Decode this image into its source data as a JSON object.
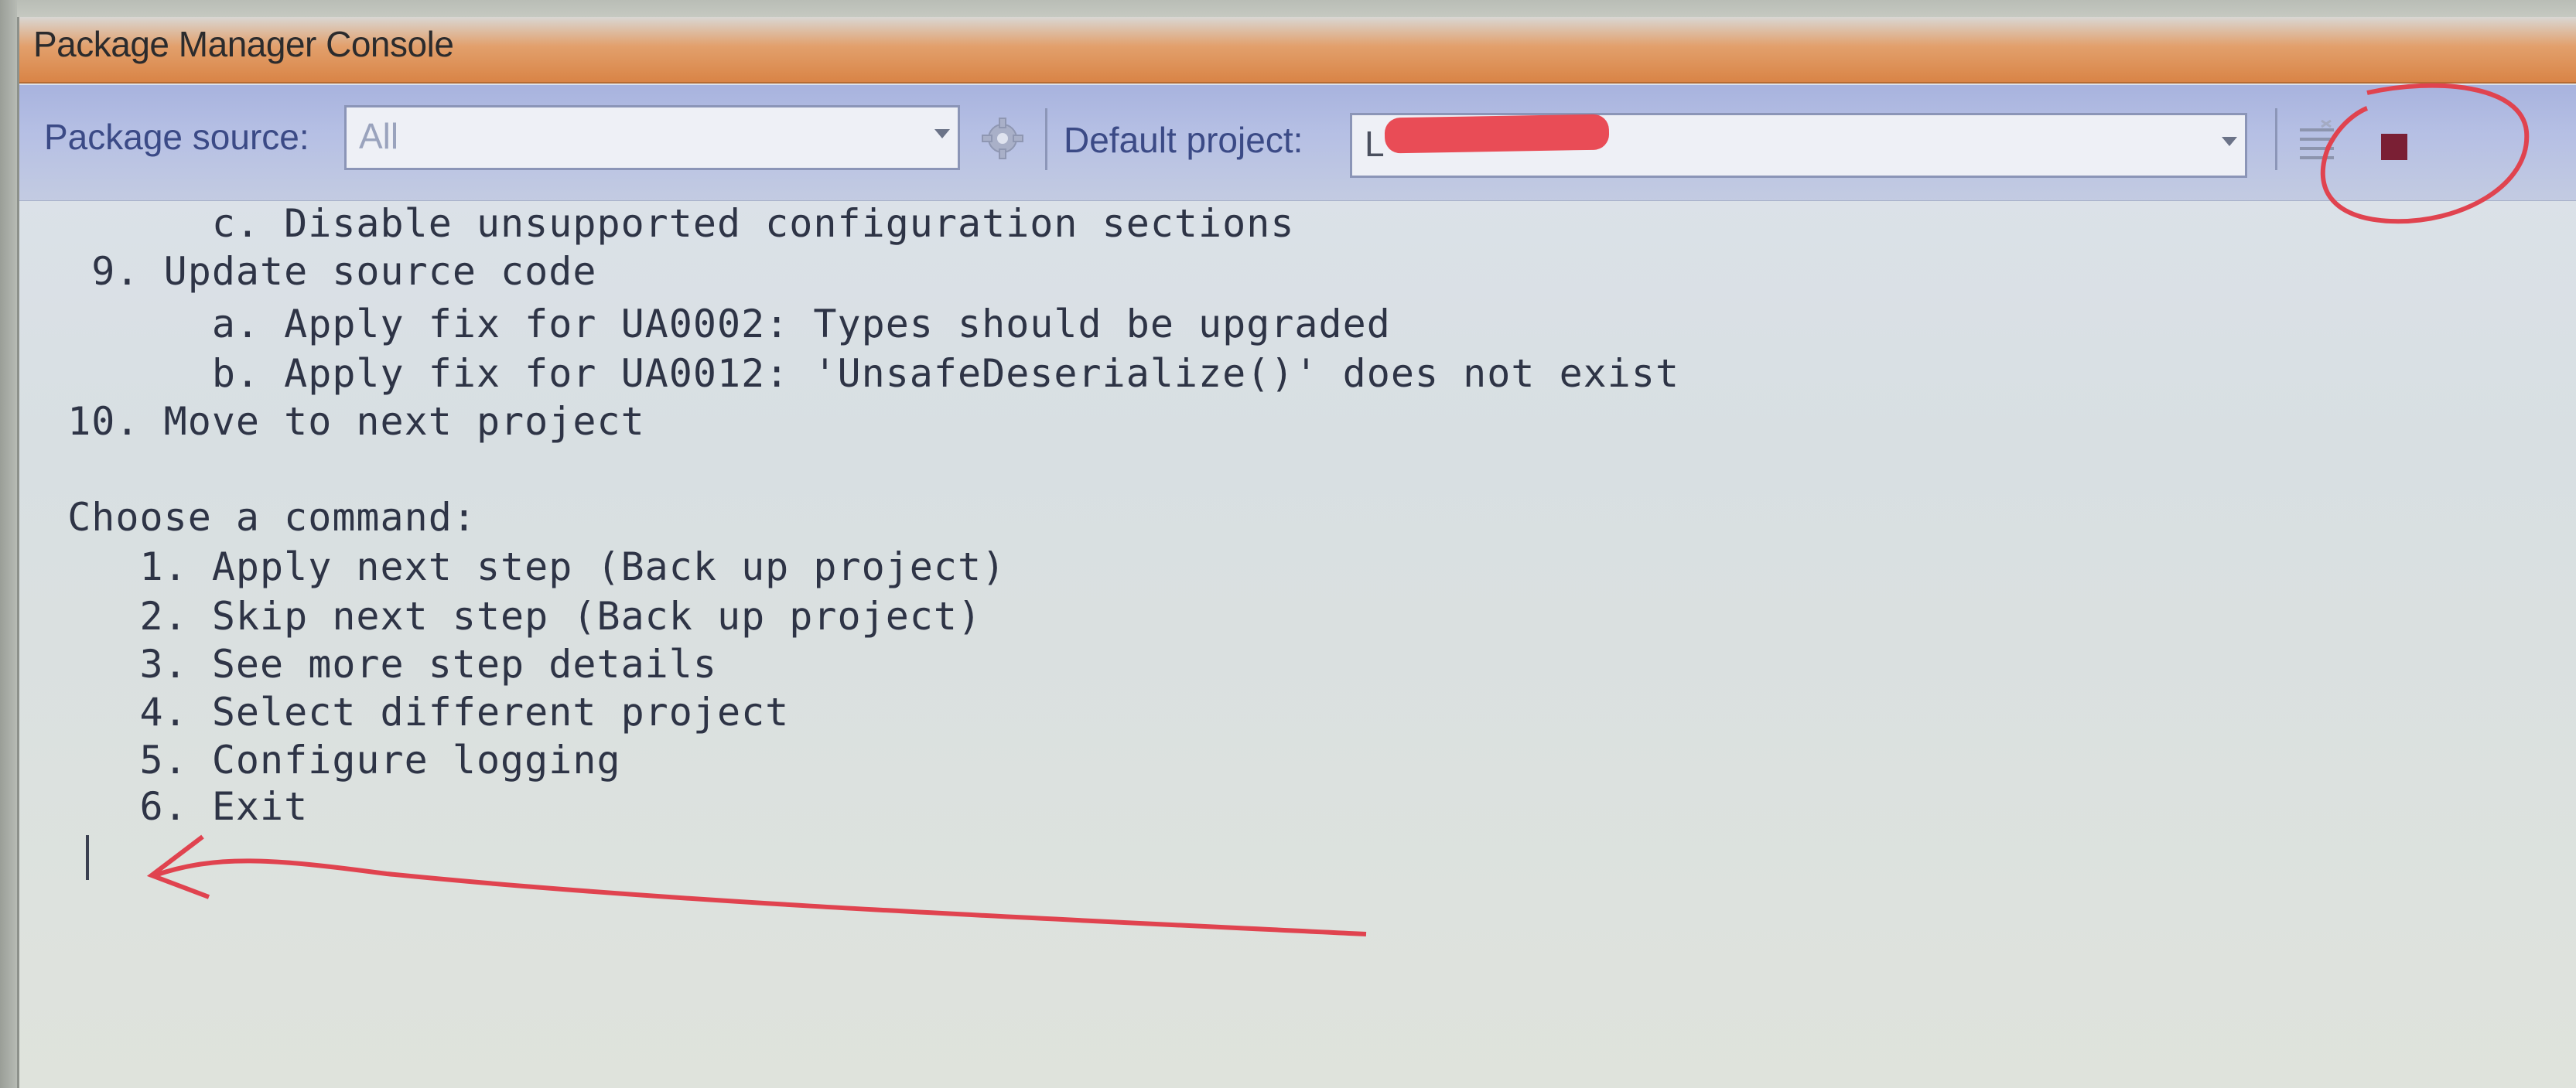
{
  "window": {
    "title": "Package Manager Console"
  },
  "toolbar": {
    "package_source_label": "Package source:",
    "package_source_value": "All",
    "default_project_label": "Default project:",
    "default_project_value": "L"
  },
  "console": {
    "lines": [
      "        c. Disable unsupported configuration sections",
      "   9. Update source code",
      "        a. Apply fix for UA0002: Types should be upgraded",
      "        b. Apply fix for UA0012: 'UnsafeDeserialize()' does not exist",
      "  10. Move to next project",
      "",
      "  Choose a command:",
      "     1. Apply next step (Back up project)",
      "     2. Skip next step (Back up project)",
      "     3. See more step details",
      "     4. Select different project",
      "     5. Configure logging",
      "     6. Exit"
    ]
  },
  "colors": {
    "title_gradient": "#d98446",
    "toolbar_bg": "#b5bfe4",
    "annotation_red": "#e0434f",
    "stop_button": "#7a1f34"
  },
  "icons": [
    "settings-gear-icon",
    "clear-console-icon",
    "stop-icon"
  ]
}
